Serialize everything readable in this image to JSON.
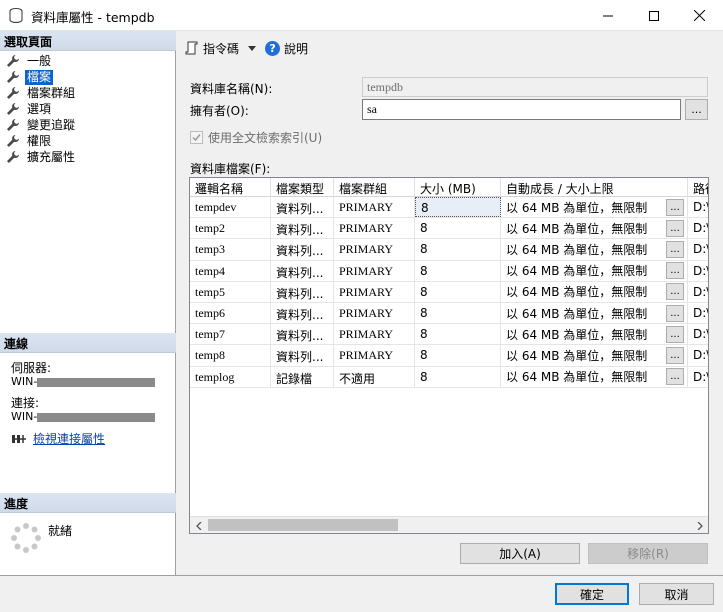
{
  "window": {
    "title": "資料庫屬性 - tempdb"
  },
  "left_pane": {
    "select_page_header": "選取頁面",
    "pages": [
      {
        "label": "一般",
        "selected": false
      },
      {
        "label": "檔案",
        "selected": true
      },
      {
        "label": "檔案群組",
        "selected": false
      },
      {
        "label": "選項",
        "selected": false
      },
      {
        "label": "變更追蹤",
        "selected": false
      },
      {
        "label": "權限",
        "selected": false
      },
      {
        "label": "擴充屬性",
        "selected": false
      }
    ],
    "connection_header": "連線",
    "server_label": "伺服器:",
    "server_value": "WIN-",
    "connection_label": "連接:",
    "connection_value": "WIN-",
    "view_connection_link": "檢視連接屬性",
    "progress_header": "進度",
    "progress_status": "就緒"
  },
  "toolbar": {
    "script_label": "指令碼",
    "help_label": "說明"
  },
  "form": {
    "db_name_label": "資料庫名稱(N):",
    "db_name_value": "tempdb",
    "owner_label": "擁有者(O):",
    "owner_value": "sa",
    "browse_button": "...",
    "fulltext_label": "使用全文檢索索引(U)",
    "fulltext_checked": true,
    "db_files_label": "資料庫檔案(F):"
  },
  "grid": {
    "columns": [
      "邏輯名稱",
      "檔案類型",
      "檔案群組",
      "大小 (MB)",
      "自動成長 / 大小上限",
      "路徑"
    ],
    "rows": [
      {
        "logical": "tempdev",
        "type": "資料列...",
        "group": "PRIMARY",
        "size": "8",
        "growth": "以 64 MB 為單位，無限制",
        "path": "D:\\"
      },
      {
        "logical": "temp2",
        "type": "資料列...",
        "group": "PRIMARY",
        "size": "8",
        "growth": "以 64 MB 為單位，無限制",
        "path": "D:\\"
      },
      {
        "logical": "temp3",
        "type": "資料列...",
        "group": "PRIMARY",
        "size": "8",
        "growth": "以 64 MB 為單位，無限制",
        "path": "D:\\"
      },
      {
        "logical": "temp4",
        "type": "資料列...",
        "group": "PRIMARY",
        "size": "8",
        "growth": "以 64 MB 為單位，無限制",
        "path": "D:\\"
      },
      {
        "logical": "temp5",
        "type": "資料列...",
        "group": "PRIMARY",
        "size": "8",
        "growth": "以 64 MB 為單位，無限制",
        "path": "D:\\"
      },
      {
        "logical": "temp6",
        "type": "資料列...",
        "group": "PRIMARY",
        "size": "8",
        "growth": "以 64 MB 為單位，無限制",
        "path": "D:\\"
      },
      {
        "logical": "temp7",
        "type": "資料列...",
        "group": "PRIMARY",
        "size": "8",
        "growth": "以 64 MB 為單位，無限制",
        "path": "D:\\"
      },
      {
        "logical": "temp8",
        "type": "資料列...",
        "group": "PRIMARY",
        "size": "8",
        "growth": "以 64 MB 為單位，無限制",
        "path": "D:\\"
      },
      {
        "logical": "templog",
        "type": "記錄檔",
        "group": "不適用",
        "size": "8",
        "growth": "以 64 MB 為單位，無限制",
        "path": "D:\\"
      }
    ],
    "ellipsis": "..."
  },
  "buttons": {
    "add": "加入(A)",
    "remove": "移除(R)",
    "ok": "確定",
    "cancel": "取消"
  },
  "colors": {
    "selection": "#0a64d0",
    "header_band": "#d6dfee",
    "link": "#0645ad"
  }
}
